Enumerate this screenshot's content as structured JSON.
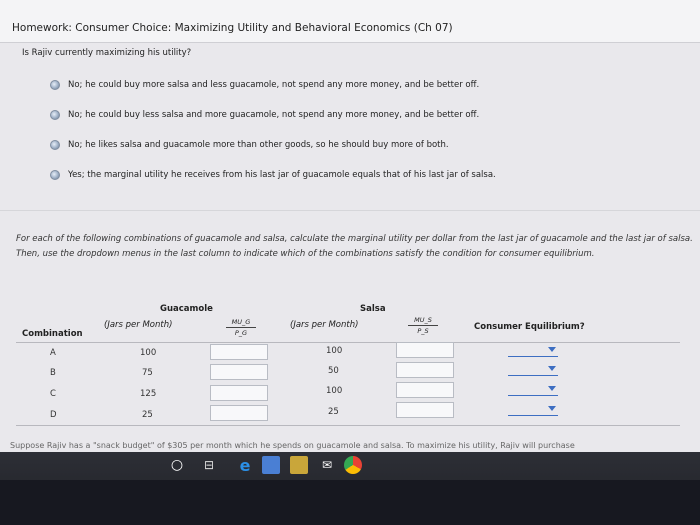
{
  "window": {
    "title": "Homework: Consumer Choice: Maximizing Utility and Behavioral Economics (Ch 07)"
  },
  "question": "Is Rajiv currently maximizing his utility?",
  "options": [
    "No; he could buy more salsa and less guacamole, not spend any more money, and be better off.",
    "No; he could buy less salsa and more guacamole, not spend any more money, and be better off.",
    "No; he likes salsa and guacamole more than other goods, so he should buy more of both.",
    "Yes; the marginal utility he receives from his last jar of guacamole equals that of his last jar of salsa."
  ],
  "instructions": "For each of the following combinations of guacamole and salsa, calculate the marginal utility per dollar from the last jar of guacamole and the last jar of salsa. Then, use the dropdown menus in the last column to indicate which of the combinations satisfy the condition for consumer equilibrium.",
  "table": {
    "header": {
      "combination": "Combination",
      "guacamole": "Guacamole",
      "guacamole_sub": "(Jars per Month)",
      "mu_g_num": "MU_G",
      "mu_g_den": "P_G",
      "salsa": "Salsa",
      "salsa_sub": "(Jars per Month)",
      "mu_s_num": "MU_S",
      "mu_s_den": "P_S",
      "equilibrium": "Consumer Equilibrium?"
    },
    "rows": [
      {
        "combo": "A",
        "guac": "100",
        "salsa": "100"
      },
      {
        "combo": "B",
        "guac": "75",
        "salsa": "50"
      },
      {
        "combo": "C",
        "guac": "125",
        "salsa": "100"
      },
      {
        "combo": "D",
        "guac": "25",
        "salsa": "25"
      }
    ]
  },
  "footer": "Suppose Rajiv has a \"snack budget\" of $305 per month which he spends on guacamole and salsa. To maximize his utility, Rajiv will purchase",
  "colors": {
    "accent": "#3d6ec2",
    "taskbar": "#2d2f36"
  },
  "taskbar_icons": [
    "start-circle-icon",
    "task-view-icon",
    "edge-icon",
    "photos-icon",
    "store-icon",
    "mail-icon",
    "chrome-icon"
  ]
}
